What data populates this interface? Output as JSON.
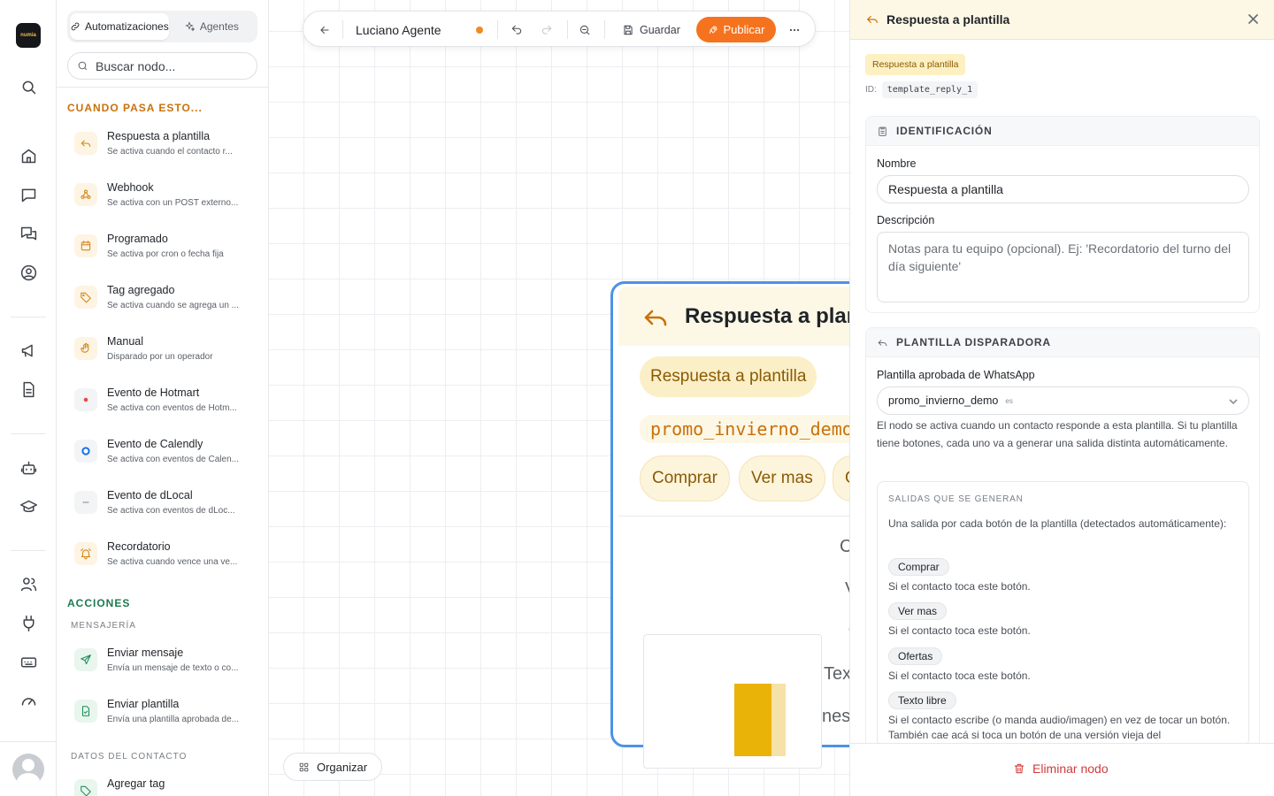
{
  "rail": {
    "logo_text": "numia",
    "icons": [
      "search-icon",
      "home-icon",
      "chat-icon",
      "conversations-icon",
      "contact-icon",
      "megaphone-icon",
      "document-icon",
      "bot-icon",
      "graduation-icon",
      "users-icon",
      "plug-icon",
      "keyboard-icon",
      "gauge-icon"
    ]
  },
  "palette": {
    "tabs": [
      {
        "label": "Automatizaciones",
        "active": true
      },
      {
        "label": "Agentes",
        "active": false
      }
    ],
    "search_placeholder": "Buscar nodo...",
    "triggers_heading": "CUANDO PASA ESTO...",
    "triggers": [
      {
        "title": "Respuesta a plantilla",
        "desc": "Se activa cuando el contacto r...",
        "icon": "reply-icon"
      },
      {
        "title": "Webhook",
        "desc": "Se activa con un POST externo...",
        "icon": "webhook-icon"
      },
      {
        "title": "Programado",
        "desc": "Se activa por cron o fecha fija",
        "icon": "calendar-icon"
      },
      {
        "title": "Tag agregado",
        "desc": "Se activa cuando se agrega un ...",
        "icon": "tag-icon"
      },
      {
        "title": "Manual",
        "desc": "Disparado por un operador",
        "icon": "hand-icon"
      },
      {
        "title": "Evento de Hotmart",
        "desc": "Se activa con eventos de Hotm...",
        "icon": "hotmart-icon"
      },
      {
        "title": "Evento de Calendly",
        "desc": "Se activa con eventos de Calen...",
        "icon": "calendly-icon"
      },
      {
        "title": "Evento de dLocal",
        "desc": "Se activa con eventos de dLoc...",
        "icon": "dlocal-icon"
      },
      {
        "title": "Recordatorio",
        "desc": "Se activa cuando vence una ve...",
        "icon": "bell-icon"
      }
    ],
    "actions_heading": "ACCIONES",
    "messaging_subheading": "MENSAJERÍA",
    "actions": [
      {
        "title": "Enviar mensaje",
        "desc": "Envía un mensaje de texto o co...",
        "icon": "send-icon"
      },
      {
        "title": "Enviar plantilla",
        "desc": "Envía una plantilla aprobada de...",
        "icon": "file-check-icon"
      }
    ],
    "contact_subheading": "DATOS DEL CONTACTO",
    "contact_actions": [
      {
        "title": "Agregar tag",
        "icon": "tags-icon"
      }
    ]
  },
  "toolbar": {
    "agent_name": "Luciano Agente",
    "save_label": "Guardar",
    "publish_label": "Publicar"
  },
  "canvas": {
    "organize_label": "Organizar",
    "node": {
      "title": "Respuesta a plantilla",
      "badge": "Respuesta a plantilla",
      "template": "promo_invierno_demo",
      "buttons": [
        "Comprar",
        "Ver mas",
        "O"
      ],
      "outputs": [
        "C",
        "V",
        "O",
        "Tex",
        "nes"
      ]
    }
  },
  "panel": {
    "title": "Respuesta a plantilla",
    "type_chip": "Respuesta a plantilla",
    "id_label": "ID:",
    "id_value": "template_reply_1",
    "identification": {
      "heading": "IDENTIFICACIÓN",
      "name_label": "Nombre",
      "name_value": "Respuesta a plantilla",
      "desc_label": "Descripción",
      "desc_placeholder": "Notas para tu equipo (opcional). Ej: 'Recordatorio del turno del día siguiente'"
    },
    "trigger": {
      "heading": "PLANTILLA DISPARADORA",
      "template_label": "Plantilla aprobada de WhatsApp",
      "template_value": "promo_invierno_demo",
      "template_lang": "es",
      "help": "El nodo se activa cuando un contacto responde a esta plantilla. Si tu plantilla tiene botones, cada uno va a generar una salida distinta automáticamente.",
      "outputs_heading": "SALIDAS QUE SE GENERAN",
      "outputs_intro": "Una salida por cada botón de la plantilla (detectados automáticamente):",
      "outputs": [
        {
          "chip": "Comprar",
          "desc": "Si el contacto toca este botón."
        },
        {
          "chip": "Ver mas",
          "desc": "Si el contacto toca este botón."
        },
        {
          "chip": "Ofertas",
          "desc": "Si el contacto toca este botón."
        },
        {
          "chip": "Texto libre",
          "desc": "Si el contacto escribe (o manda audio/imagen) en vez de tocar un botón. También cae acá si toca un botón de una versión vieja del"
        }
      ]
    },
    "delete_label": "Eliminar nodo"
  }
}
